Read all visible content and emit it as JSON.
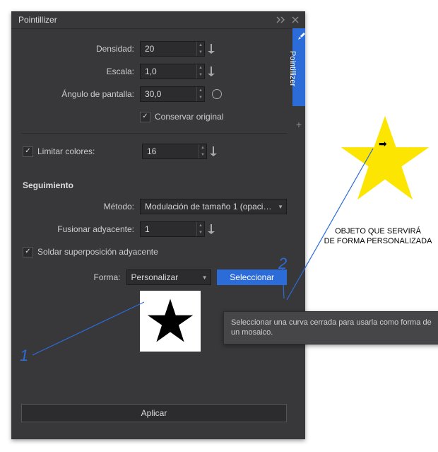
{
  "panel": {
    "title": "Pointillizer",
    "tab_label": "Pointillizer"
  },
  "fields": {
    "density_label": "Densidad:",
    "density_value": "20",
    "scale_label": "Escala:",
    "scale_value": "1,0",
    "angle_label": "Ángulo de pantalla:",
    "angle_value": "30,0",
    "preserve_label": "Conservar original",
    "limit_colors_label": "Limitar colores:",
    "limit_colors_value": "16",
    "tracking_section": "Seguimiento",
    "method_label": "Método:",
    "method_value": "Modulación de tamaño 1 (opacid…",
    "merge_label": "Fusionar adyacente:",
    "merge_value": "1",
    "weld_label": "Soldar superposición adyacente",
    "shape_label": "Forma:",
    "shape_value": "Personalizar",
    "select_btn": "Seleccionar",
    "apply_btn": "Aplicar"
  },
  "tooltip": "Seleccionar una curva cerrada para usarla como forma de un mosaico.",
  "caption_line1": "OBJETO QUE SERVIRÁ",
  "caption_line2": "DE FORMA PERSONALIZADA",
  "anno": {
    "one": "1",
    "two": "2"
  }
}
